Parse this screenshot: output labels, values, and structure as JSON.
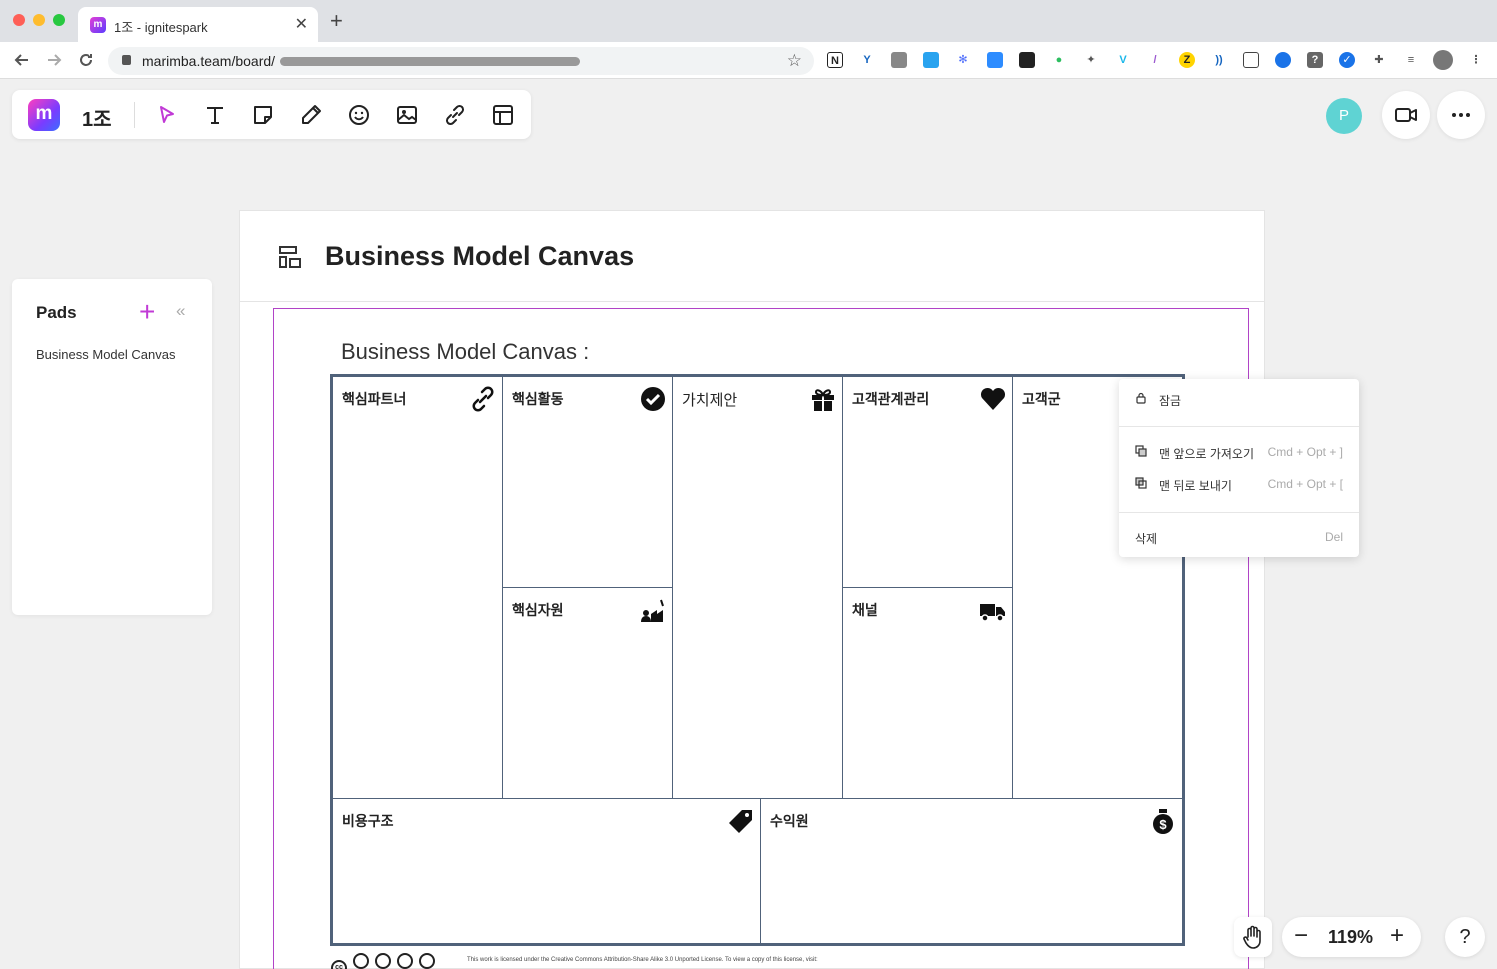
{
  "browser": {
    "tab_title": "1조 - ignitespark",
    "tab_favicon": "m",
    "url": "marimba.team/board/",
    "new_tab": "+",
    "close_tab": "✕"
  },
  "toolbar": {
    "logo": "m",
    "board_name": "1조",
    "tools": [
      "select-tool",
      "text-tool",
      "sticky-note-tool",
      "pen-tool",
      "emoji-tool",
      "image-tool",
      "link-tool",
      "template-tool"
    ]
  },
  "header": {
    "avatar_initial": "P"
  },
  "pads": {
    "title": "Pads",
    "add": "+",
    "collapse": "«",
    "items": [
      "Business Model Canvas"
    ]
  },
  "card": {
    "title": "Business Model Canvas"
  },
  "bmc": {
    "title": "Business Model Canvas :",
    "cells": {
      "key_partners": "핵심파트너",
      "key_activities": "핵심활동",
      "value_propositions": "가치제안",
      "customer_relationships": "고객관계관리",
      "customer_segments": "고객군",
      "key_resources": "핵심자원",
      "channels": "채널",
      "cost_structure": "비용구조",
      "revenue_streams": "수익원"
    },
    "license_text": "This work is licensed under the Creative Commons Attribution-Share Alike 3.0 Unported License. To view a copy of this license, visit:"
  },
  "context_menu": {
    "lock": "잠금",
    "bring_front": "맨 앞으로 가져오기",
    "bring_front_shortcut": "Cmd + Opt + ]",
    "send_back": "맨 뒤로 보내기",
    "send_back_shortcut": "Cmd + Opt + [",
    "delete": "삭제",
    "delete_shortcut": "Del"
  },
  "zoom": {
    "minus": "−",
    "value": "119%",
    "plus": "+"
  },
  "help": "?",
  "colors": {
    "accent": "#c13ad6",
    "frame": "#b143c7",
    "grid": "#50627a",
    "avatar": "#5fd3d3"
  }
}
